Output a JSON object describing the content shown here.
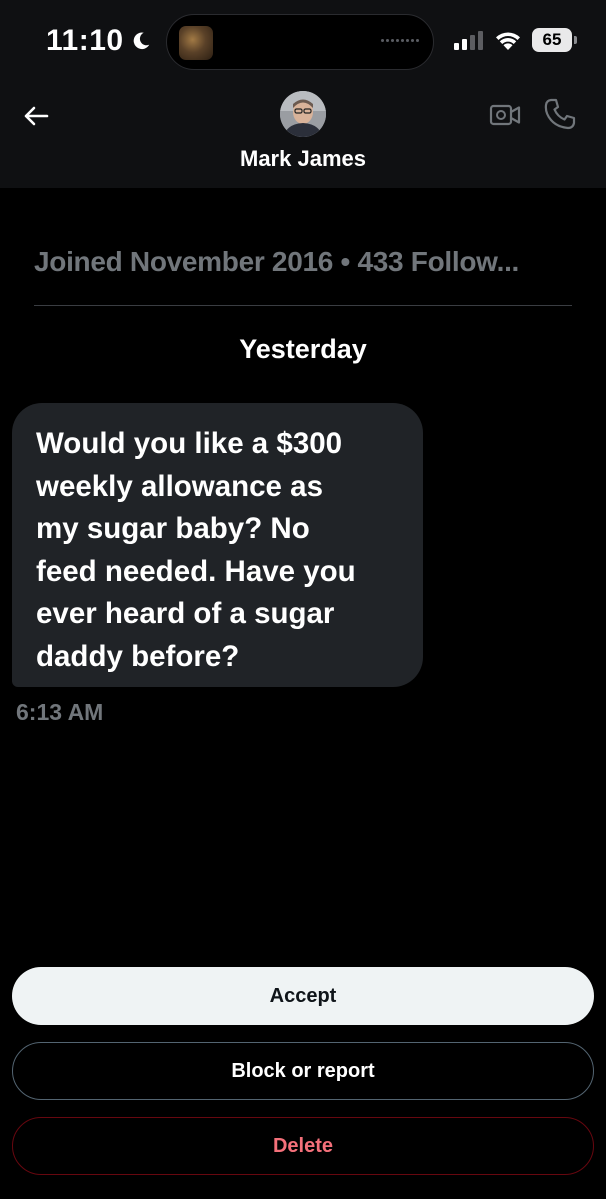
{
  "status_bar": {
    "time": "11:10",
    "battery": "65"
  },
  "header": {
    "contact_name": "Mark James"
  },
  "conversation": {
    "profile_info": "Joined November 2016 • 433 Follow...",
    "date_separator": "Yesterday",
    "message": {
      "text": "Would you like a $300\nweekly allowance as\nmy sugar baby? No\nfeed needed. Have you\never heard of a sugar\ndaddy before?",
      "time": "6:13 AM"
    }
  },
  "actions": {
    "accept_label": "Accept",
    "block_label": "Block or report",
    "delete_label": "Delete"
  },
  "colors": {
    "background": "#000000",
    "bubble": "#202327",
    "muted_text": "#71767b",
    "delete_red": "#f4212e"
  }
}
